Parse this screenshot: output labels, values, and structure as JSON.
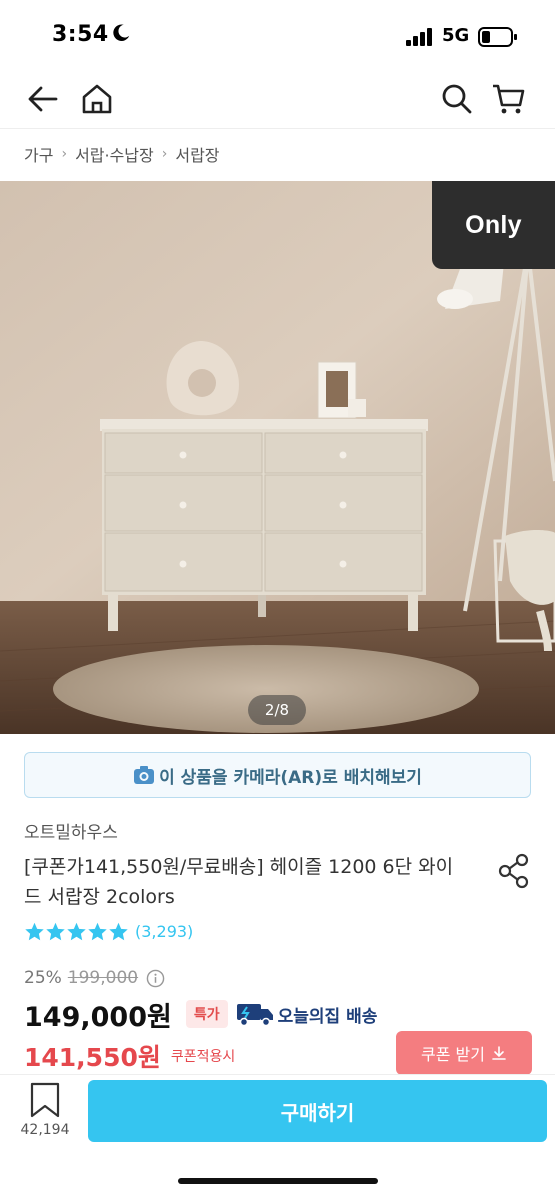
{
  "status_bar": {
    "time": "3:54",
    "network": "5G"
  },
  "breadcrumb": [
    "가구",
    "서랍·수납장",
    "서랍장"
  ],
  "hero": {
    "badge": "Only",
    "pager": "2/8"
  },
  "ar_button": {
    "label": "이 상품을 카메라(AR)로 배치해보기"
  },
  "product": {
    "brand": "오트밀하우스",
    "title": "[쿠폰가141,550원/무료배송] 헤이즐 1200 6단 와이드 서랍장 2colors",
    "rating": {
      "stars": 5,
      "count": "(3,293)"
    },
    "discount": "25%",
    "original_price": "199,000",
    "price": "149,000원",
    "special_badge": "특가",
    "delivery": "오늘의집 배송",
    "coupon_price": "141,550원",
    "coupon_note": "쿠폰적용시",
    "coupon_button": "쿠폰 받기"
  },
  "bottom_bar": {
    "bookmark_count": "42,194",
    "buy_label": "구매하기"
  },
  "colors": {
    "accent": "#35c5f0",
    "coupon": "#e5484d",
    "coupon_btn": "#f47d80"
  }
}
